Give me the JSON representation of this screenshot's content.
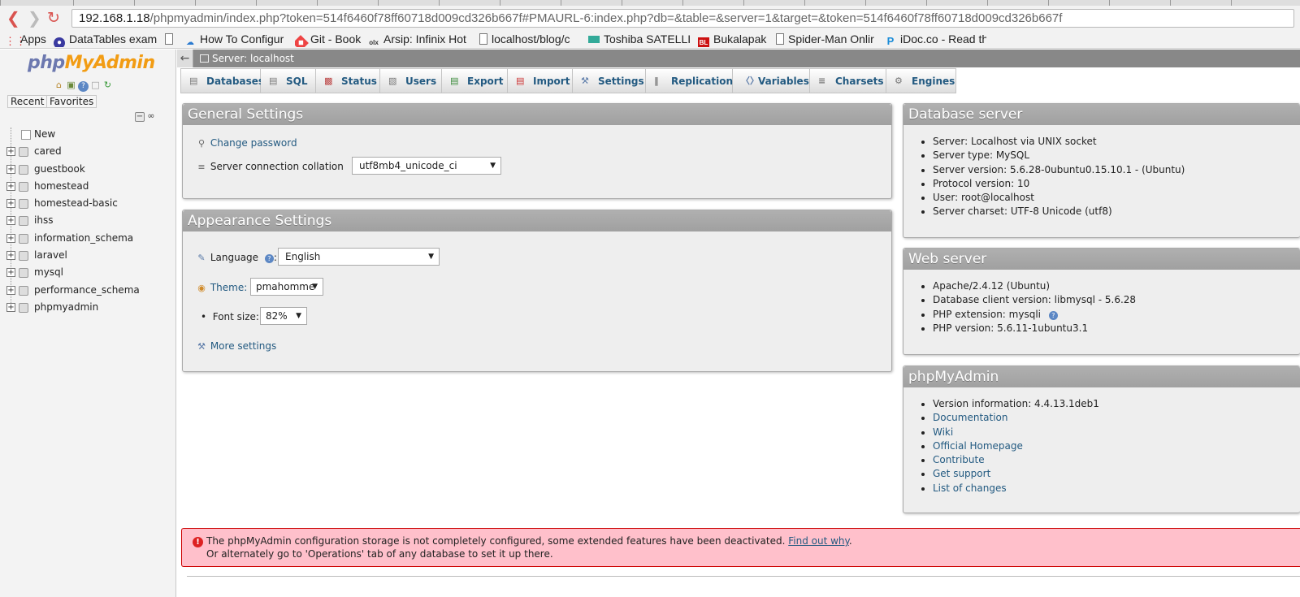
{
  "browser": {
    "url_host": "192.168.1.18",
    "url_rest": "/phpmyadmin/index.php?token=514f6460f78ff60718d009cd326b667f#PMAURL-6:index.php?db=&table=&server=1&target=&token=514f6460f78ff60718d009cd326b667f",
    "bookmarks": [
      {
        "label": "Apps",
        "icon": "apps-grid-icon",
        "color": "#d33"
      },
      {
        "label": "DataTables exam",
        "icon": "globe-icon",
        "color": "#3a3aa0"
      },
      {
        "label": "",
        "icon": "page-icon",
        "color": "#666"
      },
      {
        "label": "How To Configur",
        "icon": "cloud-icon",
        "color": "#2a7ad0"
      },
      {
        "label": "Git - Book",
        "icon": "git-icon",
        "color": "#e44"
      },
      {
        "label": "Arsip: Infinix Hot",
        "icon": "olx-icon",
        "color": "#333"
      },
      {
        "label": "localhost/blog/c",
        "icon": "page-icon",
        "color": "#666"
      },
      {
        "label": "Toshiba SATELLIT",
        "icon": "folder-icon",
        "color": "#3a9"
      },
      {
        "label": "Bukalapak",
        "icon": "bl-icon",
        "color": "#c11"
      },
      {
        "label": "Spider-Man Onlir",
        "icon": "page-icon",
        "color": "#666"
      },
      {
        "label": "iDoc.co - Read th",
        "icon": "p-icon",
        "color": "#1a8cd8"
      }
    ]
  },
  "nav": {
    "logo_php": "php",
    "logo_myadmin": "MyAdmin",
    "tab_recent": "Recent",
    "tab_favorites": "Favorites",
    "new_label": "New",
    "databases": [
      "cared",
      "guestbook",
      "homestead",
      "homestead-basic",
      "ihss",
      "information_schema",
      "laravel",
      "mysql",
      "performance_schema",
      "phpmyadmin"
    ]
  },
  "serverbar": {
    "label": "Server: localhost"
  },
  "tabs": [
    {
      "label": "Databases",
      "icon": "database-icon"
    },
    {
      "label": "SQL",
      "icon": "sql-icon"
    },
    {
      "label": "Status",
      "icon": "status-icon"
    },
    {
      "label": "Users",
      "icon": "users-icon"
    },
    {
      "label": "Export",
      "icon": "export-icon"
    },
    {
      "label": "Import",
      "icon": "import-icon"
    },
    {
      "label": "Settings",
      "icon": "wrench-icon"
    },
    {
      "label": "Replication",
      "icon": "replication-icon"
    },
    {
      "label": "Variables",
      "icon": "variables-icon"
    },
    {
      "label": "Charsets",
      "icon": "charsets-icon"
    },
    {
      "label": "Engines",
      "icon": "engines-icon"
    }
  ],
  "general": {
    "title": "General Settings",
    "change_password": "Change password",
    "collation_label": "Server connection collation",
    "collation_value": "utf8mb4_unicode_ci"
  },
  "appearance": {
    "title": "Appearance Settings",
    "language_label": "Language",
    "language_value": "English",
    "theme_label": "Theme:",
    "theme_value": "pmahomme",
    "fontsize_label": "Font size:",
    "fontsize_value": "82%",
    "more_settings": "More settings"
  },
  "db_server": {
    "title": "Database server",
    "items": [
      "Server: Localhost via UNIX socket",
      "Server type: MySQL",
      "Server version: 5.6.28-0ubuntu0.15.10.1 - (Ubuntu)",
      "Protocol version: 10",
      "User: root@localhost",
      "Server charset: UTF-8 Unicode (utf8)"
    ]
  },
  "web_server": {
    "title": "Web server",
    "items": [
      "Apache/2.4.12 (Ubuntu)",
      "Database client version: libmysql - 5.6.28",
      "PHP extension: mysqli",
      "PHP version: 5.6.11-1ubuntu3.1"
    ]
  },
  "pma": {
    "title": "phpMyAdmin",
    "version": "Version information: 4.4.13.1deb1",
    "links": [
      "Documentation",
      "Wiki",
      "Official Homepage",
      "Contribute",
      "Get support",
      "List of changes"
    ]
  },
  "notice": {
    "line1": "The phpMyAdmin configuration storage is not completely configured, some extended features have been deactivated.",
    "link": "Find out why",
    "line1_end": ".",
    "line2": "Or alternately go to 'Operations' tab of any database to set it up there."
  },
  "colors": {
    "link": "#235a81",
    "panel_header": "#a8a8a8",
    "notice_bg": "#ffc0cb"
  }
}
